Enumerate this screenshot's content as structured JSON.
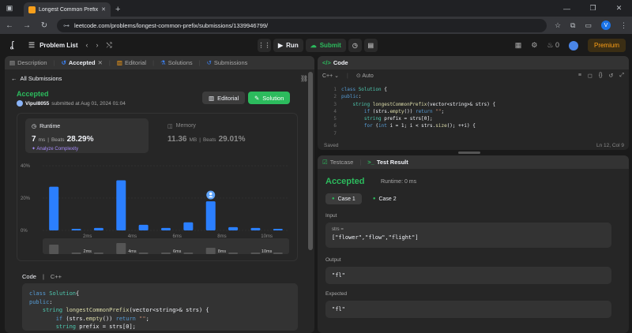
{
  "browser": {
    "tab_title": "Longest Common Prefix - Leet",
    "url": "leetcode.com/problems/longest-common-prefix/submissions/1339946799/",
    "profile_initial": "V"
  },
  "nav": {
    "problem_list": "Problem List",
    "run": "Run",
    "submit": "Submit",
    "fire_count": "0",
    "premium": "Premium"
  },
  "left_tabs": [
    "Description",
    "Accepted",
    "Editorial",
    "Solutions",
    "Submissions"
  ],
  "submission": {
    "all_submissions": "All Submissions",
    "status": "Accepted",
    "user": "Vipul8055",
    "submitted": "submitted at Aug 01, 2024 01:04",
    "editorial_btn": "Editorial",
    "solution_btn": "Solution",
    "runtime_label": "Runtime",
    "runtime_value": "7",
    "runtime_unit": "ms",
    "beats_label": "Beats",
    "runtime_beats": "28.29%",
    "analyze": "Analyze Complexity",
    "memory_label": "Memory",
    "memory_value": "11.36",
    "memory_unit": "MB",
    "memory_beats": "29.01%"
  },
  "chart_data": {
    "type": "bar",
    "ylabel": "",
    "y_ticks": [
      "0%",
      "20%",
      "40%"
    ],
    "x_ticks": [
      "2ms",
      "4ms",
      "6ms",
      "8ms",
      "10ms"
    ],
    "ylim": [
      0,
      40
    ],
    "values": [
      27,
      1,
      1.5,
      31,
      3.5,
      1.5,
      5,
      18,
      2,
      1.5,
      1
    ],
    "highlight_index": 7,
    "highlight_color": "#2563eb",
    "bar_color": "#2b7fff",
    "mini_values": [
      6,
      1,
      1,
      7,
      1,
      1,
      1,
      4,
      1,
      1,
      1
    ]
  },
  "code_section": {
    "label": "Code",
    "lang": "C++",
    "lines": [
      [
        [
          "kw",
          "class "
        ],
        [
          "ty",
          "Solution"
        ],
        [
          "",
          "{"
        ]
      ],
      [
        [
          "kw",
          "public"
        ],
        [
          "",
          ":"
        ]
      ],
      [
        [
          "",
          "    "
        ],
        [
          "ty",
          "string "
        ],
        [
          "fn",
          "longestCommonPrefix"
        ],
        [
          "",
          "(vector<string>& strs) {"
        ]
      ],
      [
        [
          "",
          "        "
        ],
        [
          "kw",
          "if "
        ],
        [
          "",
          "(strs."
        ],
        [
          "fn",
          "empty"
        ],
        [
          "",
          "()) "
        ],
        [
          "kw",
          "return "
        ],
        [
          "st",
          "\"\""
        ],
        [
          "",
          ";"
        ]
      ],
      [
        [
          "",
          "        "
        ],
        [
          "ty",
          "string "
        ],
        [
          "",
          "prefix = strs[0];"
        ]
      ]
    ]
  },
  "editor": {
    "title": "Code",
    "lang": "C++",
    "mode": "Auto",
    "line_numbers": [
      "1",
      "2",
      "3",
      "4",
      "5",
      "6",
      "7"
    ],
    "lines": [
      [
        [
          "kw",
          "class "
        ],
        [
          "ty",
          "Solution "
        ],
        [
          "",
          "{"
        ]
      ],
      [
        [
          "kw",
          "public"
        ],
        [
          "",
          ":"
        ]
      ],
      [
        [
          "",
          "    "
        ],
        [
          "ty",
          "string "
        ],
        [
          "fn",
          "longestCommonPrefix"
        ],
        [
          "",
          "(vector<string>& strs) {"
        ]
      ],
      [
        [
          "",
          "        "
        ],
        [
          "kw",
          "if "
        ],
        [
          "",
          "(strs."
        ],
        [
          "fn",
          "empty"
        ],
        [
          "",
          "()) "
        ],
        [
          "kw",
          "return "
        ],
        [
          "st",
          "\"\""
        ],
        [
          "",
          ";"
        ]
      ],
      [
        [
          "",
          "        "
        ],
        [
          "ty",
          "string "
        ],
        [
          "",
          "prefix = strs[0];"
        ]
      ],
      [
        [
          "",
          "        "
        ],
        [
          "kw",
          "for "
        ],
        [
          "",
          "("
        ],
        [
          "kw",
          "int "
        ],
        [
          "",
          "i = 1; i < strs."
        ],
        [
          "fn",
          "size"
        ],
        [
          "",
          "(); ++i) {"
        ]
      ],
      [
        [
          "",
          ""
        ]
      ]
    ],
    "saved": "Saved",
    "cursor": "Ln 12, Col 9"
  },
  "result": {
    "tab_testcase": "Testcase",
    "tab_result": "Test Result",
    "status": "Accepted",
    "runtime": "Runtime: 0 ms",
    "case1": "Case 1",
    "case2": "Case 2",
    "input_label": "Input",
    "var_name": "strs =",
    "input_value": "[\"flower\",\"flow\",\"flight\"]",
    "output_label": "Output",
    "output_value": "\"fl\"",
    "expected_label": "Expected",
    "expected_value": "\"fl\""
  }
}
